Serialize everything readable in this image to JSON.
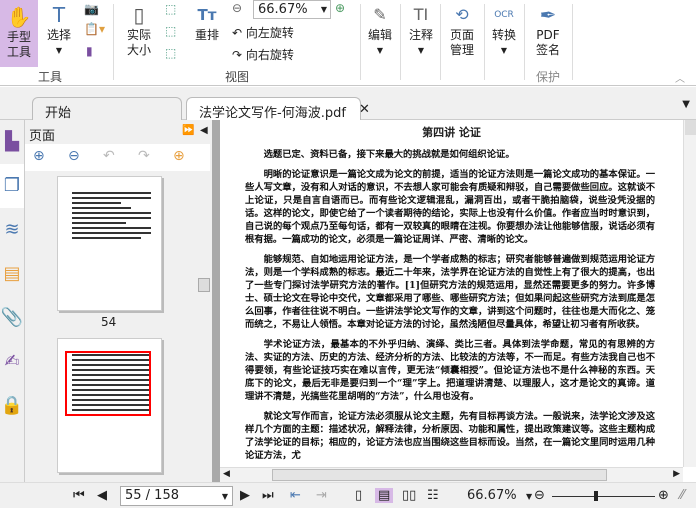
{
  "ribbon": {
    "hand_tool": "手型工具",
    "select": "选择",
    "actual_size": "实际大小",
    "reflow": "重排",
    "zoom_value": "66.67%",
    "rotate_left": "向左旋转",
    "rotate_right": "向右旋转",
    "edit": "编辑",
    "annotate": "注释",
    "page_manage": "页面管理",
    "convert": "转换",
    "pdf_sign": "PDF签名",
    "groups": {
      "tools": "工具",
      "view": "视图",
      "protect": "保护"
    }
  },
  "tabs": [
    {
      "label": "开始"
    },
    {
      "label": "法学论文写作-何海波.pdf"
    }
  ],
  "panel": {
    "title": "页面",
    "thumb_page_label": "54"
  },
  "document": {
    "title": "第四讲 论证",
    "paragraphs": [
      "选题已定、资料已备，接下来最大的挑战就是如何组织论证。",
      "明晰的论证意识是一篇论文成为论文的前提，适当的论证方法则是一篇论文成功的基本保证。一些人写文章，没有和人对话的意识，不去想人家可能会有质疑和辩驳，自己需要做些回应。这就谈不上论证，只是自言自语而已。而有些论文逻辑混乱，漏洞百出，或者干脆拍脑袋，说些没凭没据的话。这样的论文，即使它给了一个读者期待的结论，实际上也没有什么价值。作者应当时时意识到，自己说的每个观点乃至每句话，都有一双较真的眼睛在注视。你要想办法让他能够信服，说话必须有根有据。一篇成功的论文，必须是一篇论证周详、严密、清晰的论文。",
      "能够规范、自如地运用论证方法，是一个学者成熟的标志；研究者能够普遍做到规范运用论证方法，则是一个学科成熟的标志。最近二十年来，法学界在论证方法的自觉性上有了很大的提高，也出了一些专门探讨法学研究方法的著作。[1]但研究方法的规范运用，显然还需要更多的努力。许多博士、硕士论文在导论中交代，文章都采用了哪些、哪些研究方法；但如果问起这些研究方法到底是怎么回事，作者往往说不明白。一些讲法学论文写作的文章，讲到这个问题时，往往也是大而化之、笼而统之，不易让人领悟。本章对论证方法的讨论，虽然浅陋但尽量具体，希望让初习者有所收获。",
      "学术论证方法，最基本的不外乎归纳、演绎、类比三者。具体到法学命题，常见的有思辨的方法、实证的方法、历史的方法、经济分析的方法、比较法的方法等，不一而足。有些方法我自己也不得要领，有些论证技巧实在难以言传，更无法“倾囊相授”。但论证方法也不是什么神秘的东西。天底下的论文，最后无非是要归到一个“理”字上。把道理讲清楚、以理服人，这才是论文的真谛。道理讲不清楚，光搞些花里胡哨的“方法”，什么用也没有。",
      "就论文写作而言，论证方法必须服从论文主题，先有目标再谈方法。一般说来，法学论文涉及这样几个方面的主题：描述状况，解释法律，分析原因、功能和属性，提出政策建议等。这些主题构成了法学论证的目标；相应的，论证方法也应当围绕这些目标而设。当然，在一篇论文里同时运用几种论证方法，尤"
    ]
  },
  "status": {
    "page_input": "55 / 158",
    "zoom": "66.67%"
  },
  "colors": {
    "accent": "#d7b9e6",
    "link": "#4a78b0",
    "thumb_highlight": "#ff0000"
  }
}
